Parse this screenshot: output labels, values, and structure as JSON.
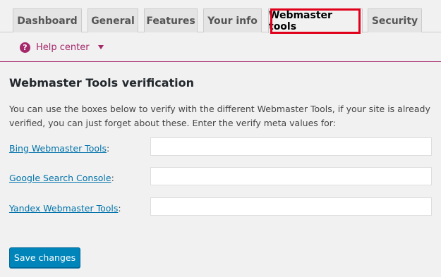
{
  "tabs": [
    {
      "label": "Dashboard"
    },
    {
      "label": "General"
    },
    {
      "label": "Features"
    },
    {
      "label": "Your info"
    },
    {
      "label": "Webmaster tools",
      "active": true
    },
    {
      "label": "Security"
    }
  ],
  "help": {
    "label": "Help center",
    "icon": "question-circle-icon"
  },
  "section": {
    "title": "Webmaster Tools verification",
    "description": "You can use the boxes below to verify with the different Webmaster Tools, if your site is already verified, you can just forget about these. Enter the verify meta values for:"
  },
  "fields": [
    {
      "label": "Bing Webmaster Tools",
      "value": ""
    },
    {
      "label": "Google Search Console",
      "value": ""
    },
    {
      "label": "Yandex Webmaster Tools",
      "value": ""
    }
  ],
  "save_button": {
    "label": "Save changes"
  },
  "colors": {
    "accent": "#a4286a",
    "link": "#0073aa",
    "button": "#0085ba",
    "highlight": "#e0001b"
  }
}
